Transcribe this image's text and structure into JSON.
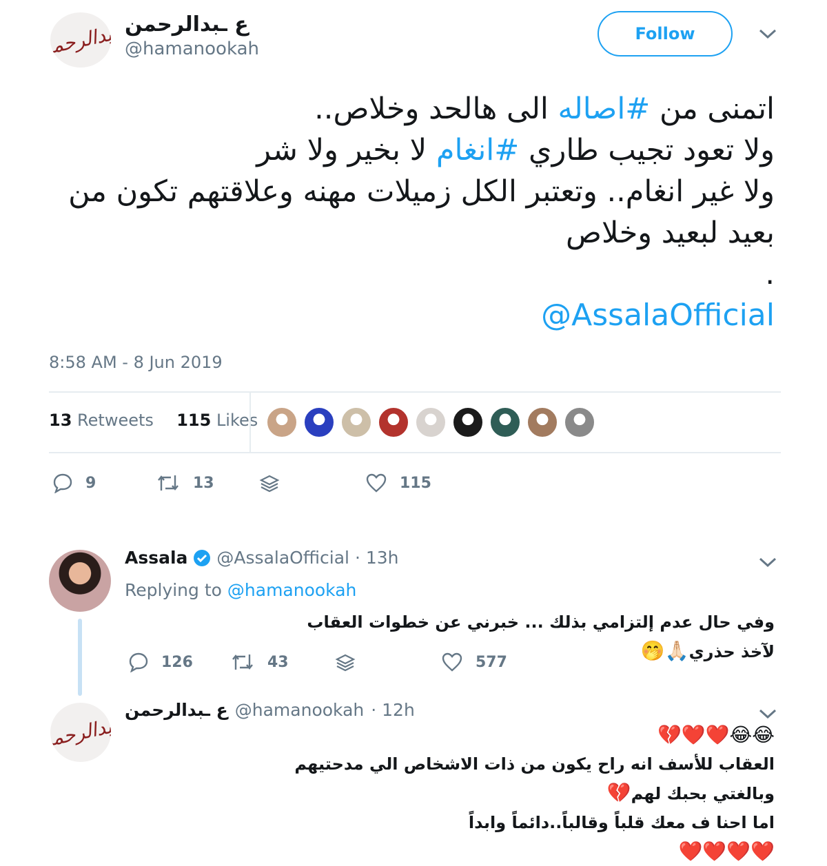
{
  "tweet": {
    "author_name": "ع ـبدالرحمن",
    "author_handle": "@hamanookah",
    "avatar_logo": "عبدالرحمن",
    "follow_label": "Follow",
    "text_lines": [
      {
        "a": "اتمنى من ",
        "tag": "#اصاله",
        "b": " الى هالحد وخلاص.."
      },
      {
        "a": "ولا تعود تجيب طاري ",
        "tag": "#انغام",
        "b": " لا بخير ولا شر"
      },
      {
        "a": "ولا غير انغام.. وتعتبر الكل زميلات مهنه وعلاقتهم تكون من",
        "tag": "",
        "b": ""
      },
      {
        "a": "بعيد لبعيد وخلاص",
        "tag": "",
        "b": ""
      },
      {
        "a": ".",
        "tag": "",
        "b": ""
      }
    ],
    "mention": "@AssalaOfficial",
    "timestamp": "8:58 AM - 8 Jun 2019",
    "retweets_count": "13",
    "retweets_label": "Retweets",
    "likes_count": "115",
    "likes_label": "Likes",
    "liker_colors": [
      "#c9a487",
      "#2a3fbf",
      "#cdbfa8",
      "#b3332d",
      "#d8d3cf",
      "#1b1b1b",
      "#2f5d56",
      "#a27b5f",
      "#8a8a8a"
    ],
    "actions": {
      "replies": "9",
      "retweets": "13",
      "likes": "115"
    }
  },
  "reply1": {
    "name": "Assala",
    "handle": "@AssalaOfficial",
    "time": "· 13h",
    "replying_label": "Replying to",
    "replying_handle": "@hamanookah",
    "text": "وفي حال عدم إلتزامي بذلك ... خبرني عن خطوات العقاب لآخذ حذري",
    "emojis": "🙏🏻🤭",
    "actions": {
      "replies": "126",
      "retweets": "43",
      "likes": "577"
    }
  },
  "reply2": {
    "name": "ع ـبدالرحمن",
    "handle": "@hamanookah",
    "time": "· 12h",
    "emoji_line": "😂😂❤️❤️💔",
    "line1": "العقاب للأسف انه راح يكون من ذات الاشخاص الي مدحتيهم وبالغتي بحبك لهم",
    "line1_emoji": "💔",
    "line2": "اما احنا ف معك قلباً وقالباً..دائماً وابداً",
    "hearts": "❤️❤️❤️❤️"
  },
  "colors": {
    "link": "#1da1f2",
    "muted": "#657786",
    "verified": "#1da1f2"
  },
  "icons": [
    "reply-icon",
    "retweet-icon",
    "dm-icon",
    "heart-icon",
    "chevron-down-icon",
    "verified-badge-icon"
  ]
}
